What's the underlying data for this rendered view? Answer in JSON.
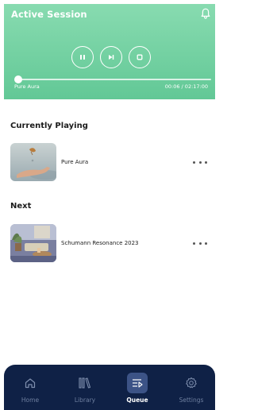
{
  "session": {
    "title": "Active Session",
    "notification_icon": "bell-icon",
    "track_name": "Pure Aura",
    "time_readout": "00:06 / 02:17:00",
    "progress": 0.0005,
    "controls": [
      {
        "name": "pause-button",
        "icon": "pause-icon"
      },
      {
        "name": "next-button",
        "icon": "skip-next-icon"
      },
      {
        "name": "stop-button",
        "icon": "stop-icon"
      }
    ],
    "accent": "#6fd1a0"
  },
  "queue": {
    "current_heading": "Currently Playing",
    "current": {
      "title": "Pure Aura",
      "thumbnail": "hand-with-floating-leaf-image"
    },
    "next_heading": "Next",
    "next": [
      {
        "title": "Schumann Resonance 2023",
        "thumbnail": "cozy-room-with-plants-image"
      }
    ]
  },
  "nav": {
    "items": [
      {
        "label": "Home",
        "icon": "home-icon",
        "active": false
      },
      {
        "label": "Library",
        "icon": "library-icon",
        "active": false
      },
      {
        "label": "Queue",
        "icon": "queue-icon",
        "active": true
      },
      {
        "label": "Settings",
        "icon": "settings-icon",
        "active": false
      }
    ],
    "background": "#0f2146"
  }
}
